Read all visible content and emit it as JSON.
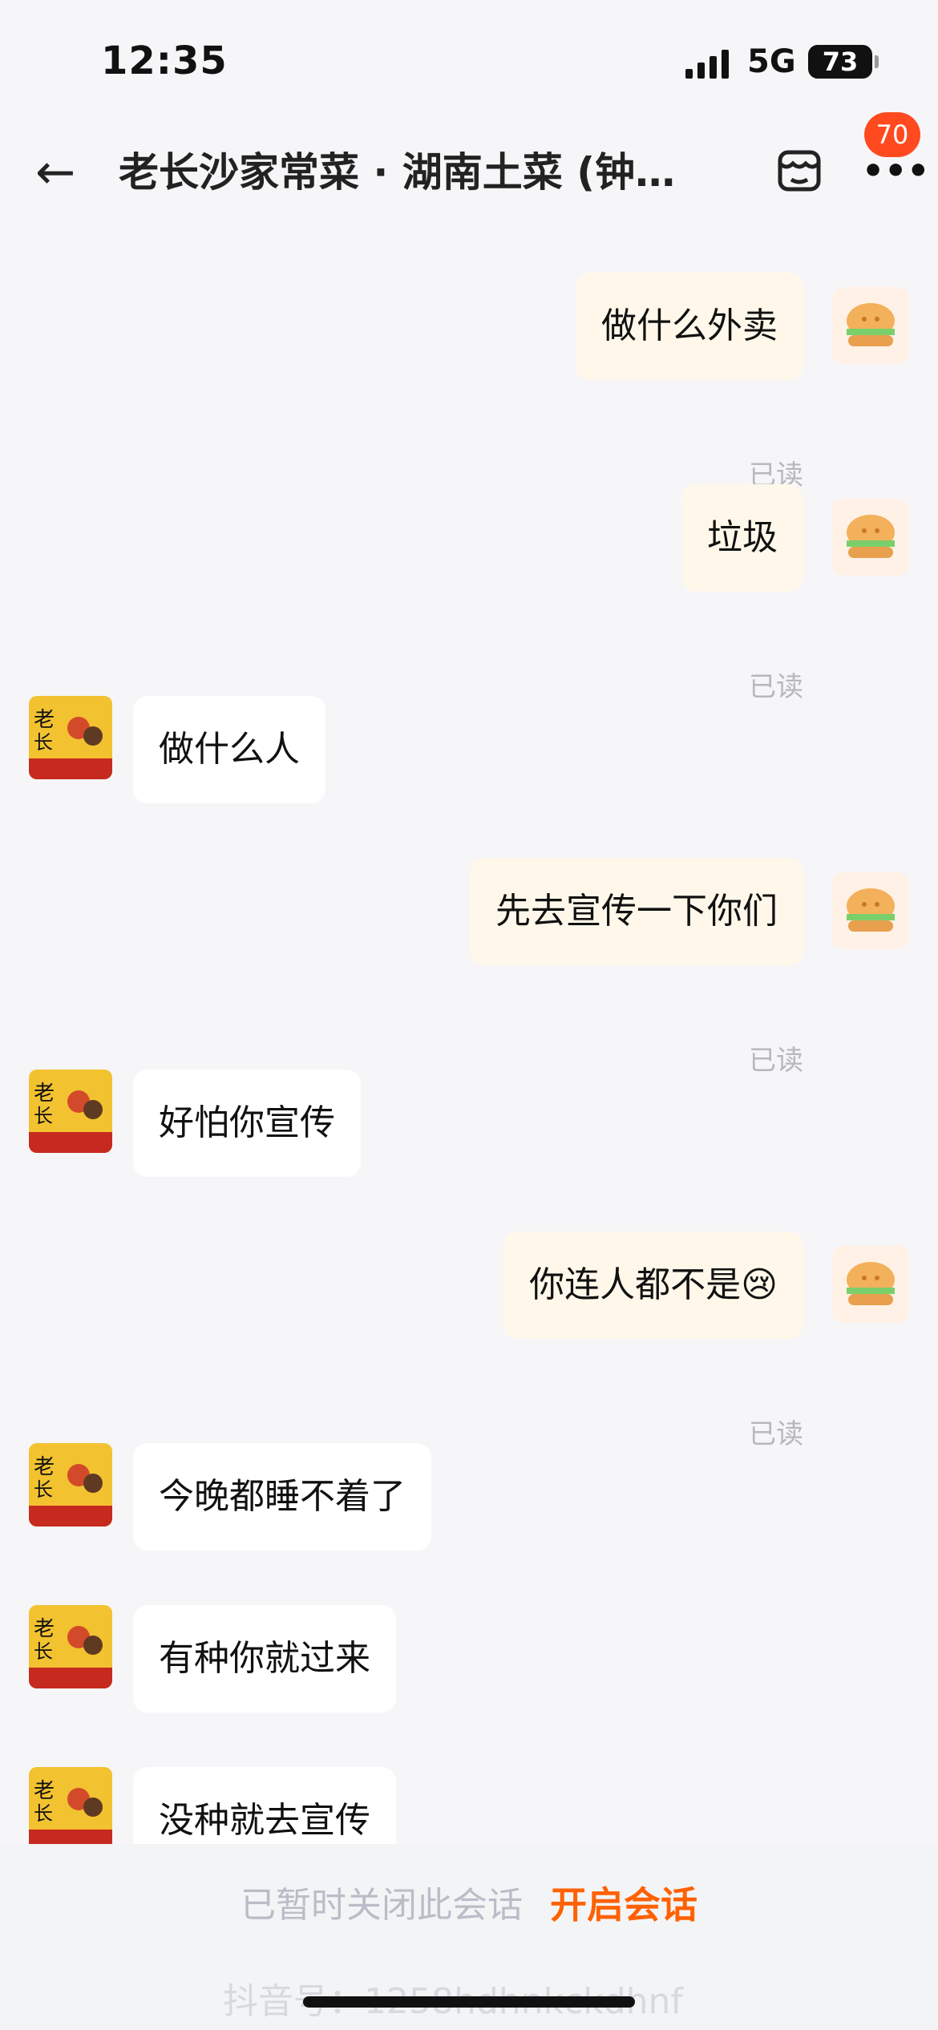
{
  "status": {
    "time": "12:35",
    "network": "5G",
    "battery": "73"
  },
  "header": {
    "title": "老长沙家常菜 · 湖南土菜 (钟…",
    "badge": "70"
  },
  "messages": [
    {
      "side": "self",
      "text": "做什么外卖",
      "read": "已读"
    },
    {
      "side": "self",
      "text": "垃圾",
      "read": "已读"
    },
    {
      "side": "other",
      "text": "做什么人"
    },
    {
      "side": "self",
      "text": "先去宣传一下你们",
      "read": "已读"
    },
    {
      "side": "other",
      "text": "好怕你宣传"
    },
    {
      "side": "self",
      "text": "你连人都不是😢",
      "read": "已读"
    },
    {
      "side": "other",
      "text": "今晚都睡不着了"
    },
    {
      "side": "other",
      "text": "有种你就过来"
    },
    {
      "side": "other",
      "text": "没种就去宣传"
    }
  ],
  "footer": {
    "closed_notice": "已暂时关闭此会话",
    "open_label": "开启会话",
    "watermark": "抖音号：1258hdhnkckdhnf"
  },
  "icons": {
    "back": "back-arrow-icon",
    "store": "store-icon",
    "more": "more-icon",
    "avatar_self": "burger-avatar-icon",
    "avatar_other": "restaurant-logo-avatar"
  }
}
